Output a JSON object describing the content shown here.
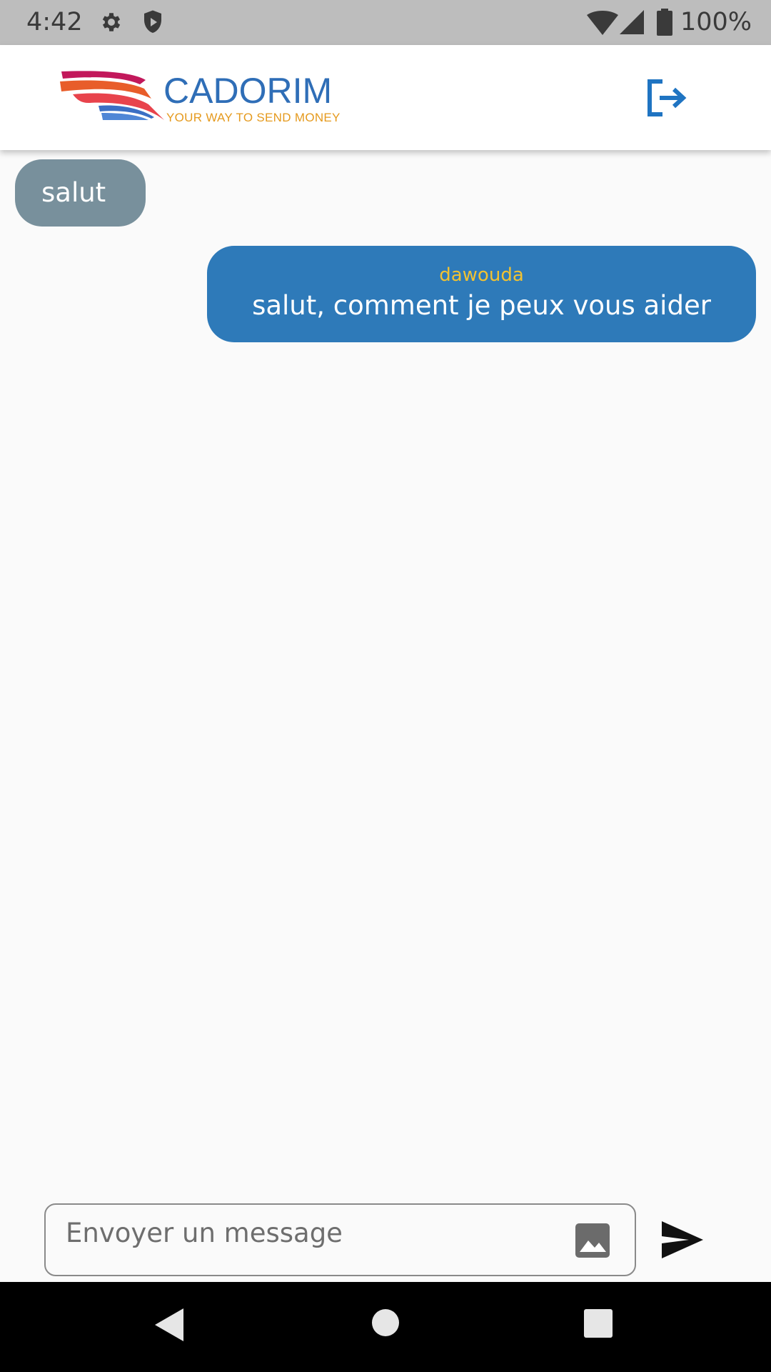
{
  "status_bar": {
    "time": "4:42",
    "battery_text": "100%",
    "icons": [
      "gear-icon",
      "shield-icon",
      "wifi-icon",
      "cell-signal-icon",
      "battery-icon"
    ]
  },
  "header": {
    "logo_name": "CADORIM",
    "logo_tagline": "YOUR WAY TO SEND MONEY",
    "logout_icon": "logout-icon"
  },
  "messages": [
    {
      "direction": "incoming",
      "text": "salut"
    },
    {
      "direction": "outgoing",
      "sender": "dawouda",
      "text": "salut, comment je peux vous aider"
    }
  ],
  "composer": {
    "placeholder": "Envoyer un message",
    "value": "",
    "attach_icon": "image-icon",
    "send_icon": "send-icon"
  },
  "colors": {
    "incoming_bubble": "#78909c",
    "outgoing_bubble": "#2e7ab9",
    "sender_name": "#f1c232",
    "brand_blue": "#2f6eb7",
    "brand_orange": "#e59a1e"
  }
}
